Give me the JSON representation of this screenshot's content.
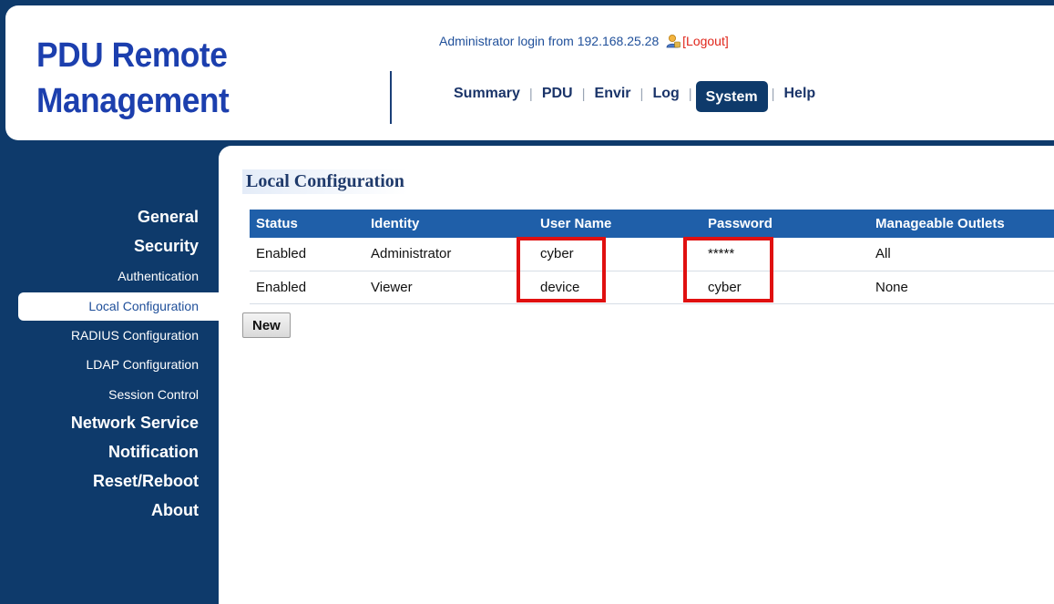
{
  "app": {
    "title_line1": "PDU Remote",
    "title_line2": "Management"
  },
  "header": {
    "login_text": "Administrator login from 192.168.25.28",
    "logout_label": "Logout",
    "user_icon": "user-icon"
  },
  "topnav": {
    "items": [
      {
        "label": "Summary"
      },
      {
        "label": "PDU"
      },
      {
        "label": "Envir"
      },
      {
        "label": "Log"
      },
      {
        "label": "System"
      },
      {
        "label": "Help"
      }
    ],
    "separator": "|",
    "active": "System"
  },
  "sidebar": {
    "items": [
      {
        "label": "General",
        "level": "major"
      },
      {
        "label": "Security",
        "level": "major"
      },
      {
        "label": "Authentication",
        "level": "minor"
      },
      {
        "label": "Local Configuration",
        "level": "minor",
        "selected": true
      },
      {
        "label": "RADIUS Configuration",
        "level": "minor"
      },
      {
        "label": "LDAP Configuration",
        "level": "minor"
      },
      {
        "label": "Session Control",
        "level": "minor"
      },
      {
        "label": "Network Service",
        "level": "major"
      },
      {
        "label": "Notification",
        "level": "major"
      },
      {
        "label": "Reset/Reboot",
        "level": "major"
      },
      {
        "label": "About",
        "level": "major"
      }
    ]
  },
  "main": {
    "page_title": "Local Configuration",
    "table": {
      "headers": [
        "Status",
        "Identity",
        "User Name",
        "Password",
        "Manageable Outlets"
      ],
      "rows": [
        [
          "Enabled",
          "Administrator",
          "cyber",
          "*****",
          "All"
        ],
        [
          "Enabled",
          "Viewer",
          "device",
          "cyber",
          "None"
        ]
      ]
    },
    "new_button_label": "New"
  },
  "colors": {
    "navy": "#0e3a6b",
    "logo_blue": "#1c3fae",
    "table_header": "#1f5fa9",
    "highlight_red": "#e01010",
    "logout_red": "#e0261b"
  }
}
